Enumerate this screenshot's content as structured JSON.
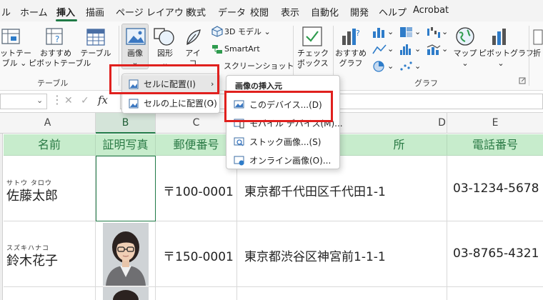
{
  "tabs": [
    "ル",
    "ホーム",
    "挿入",
    "描画",
    "ページ レイアウト",
    "数式",
    "データ",
    "校閲",
    "表示",
    "自動化",
    "開発",
    "ヘルプ",
    "Acrobat"
  ],
  "active_tab": "挿入",
  "ribbon": {
    "pivot_label_1": "ットテー",
    "pivot_label_2": "ブル ⌄",
    "recommended_pivot_1": "おすすめ",
    "recommended_pivot_2": "ピボットテーブル",
    "table_label": "テーブル",
    "picture_label": "画像",
    "picture_caret": "⌄",
    "shapes_label": "図形",
    "shapes_caret": "⌄",
    "icons_label": "アイ",
    "icons_label_2": "コ",
    "model3d_label": "3D モデル  ⌄",
    "smartart_label": "SmartArt",
    "screenshot_label": "スクリーンショット  ⌄",
    "checkbox_label_1": "チェック",
    "checkbox_label_2": "ボックス",
    "recommended_chart_1": "おすすめ",
    "recommended_chart_2": "グラフ",
    "map_label": "マップ",
    "map_caret": "⌄",
    "pivotchart_label": "ピボットグラフ",
    "pivotchart_caret": "⌄",
    "fold_label": "折",
    "group_table": "テーブル",
    "group_chart": "グラフ"
  },
  "formula_bar": {
    "fx": "fx",
    "cancel": "✕",
    "enter": "✓",
    "value": ""
  },
  "columns": [
    "A",
    "B",
    "C",
    "D",
    "E"
  ],
  "selected_column": "B",
  "table": {
    "headers": [
      "名前",
      "証明写真",
      "郵便番号",
      "所",
      "電話番号"
    ],
    "rows": [
      {
        "ruby": "サトウ タロウ",
        "name": "佐藤太郎",
        "zip": "〒100-0001",
        "address": "東京都千代田区千代田1-1",
        "phone": "03-1234-5678"
      },
      {
        "ruby": "スズキハナコ",
        "name": "鈴木花子",
        "zip": "〒150-0001",
        "address": "東京都渋谷区神宮前1-1-1",
        "phone": "03-8765-4321"
      }
    ]
  },
  "picture_menu": {
    "items": [
      "セルに配置(I)",
      "セルの上に配置(O)"
    ]
  },
  "insert_from_menu": {
    "title": "画像の挿入元",
    "items": [
      "このデバイス...(D)",
      "モバイル デバイス(M)...",
      "ストック画像...(S)",
      "オンライン画像(O)..."
    ]
  },
  "colors": {
    "accent": "#1f7a46",
    "header_fill": "#c7eccc",
    "header_text": "#2a7a45",
    "highlight_box": "#e0201e"
  }
}
